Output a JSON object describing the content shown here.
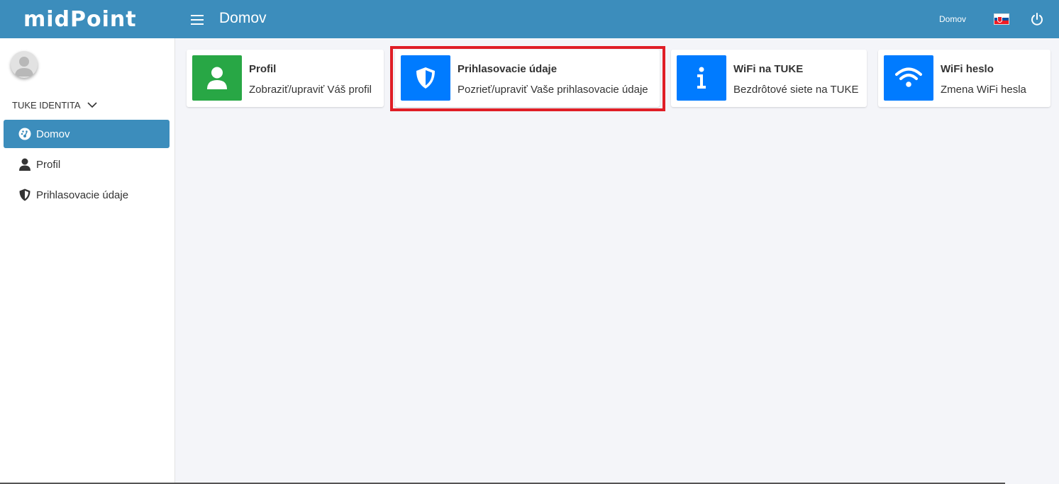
{
  "header": {
    "logo": "midPoint",
    "title": "Domov",
    "breadcrumb": "Domov",
    "flag_icon": "slovakia-flag-icon",
    "logout_icon": "power-icon",
    "brand_color": "#3c8dbc"
  },
  "sidebar": {
    "avatar_icon": "user-avatar-icon",
    "section_title": "TUKE IDENTITA",
    "items": [
      {
        "label": "Domov",
        "icon": "dashboard-icon",
        "active": true
      },
      {
        "label": "Profil",
        "icon": "user-icon",
        "active": false
      },
      {
        "label": "Prihlasovacie údaje",
        "icon": "shield-icon",
        "active": false
      }
    ]
  },
  "cards": [
    {
      "title": "Profil",
      "description": "Zobraziť/upraviť Váš profil",
      "icon": "user-icon",
      "color": "#28a745"
    },
    {
      "title": "Prihlasovacie údaje",
      "description": "Pozrieť/upraviť Vaše prihlasovacie údaje",
      "icon": "shield-icon",
      "color": "#007bff",
      "highlighted": true,
      "highlight_color": "#e01e26"
    },
    {
      "title": "WiFi na TUKE",
      "description": "Bezdrôtové siete na TUKE",
      "icon": "info-icon",
      "color": "#007bff"
    },
    {
      "title": "WiFi heslo",
      "description": "Zmena WiFi hesla",
      "icon": "wifi-icon",
      "color": "#007bff"
    }
  ]
}
